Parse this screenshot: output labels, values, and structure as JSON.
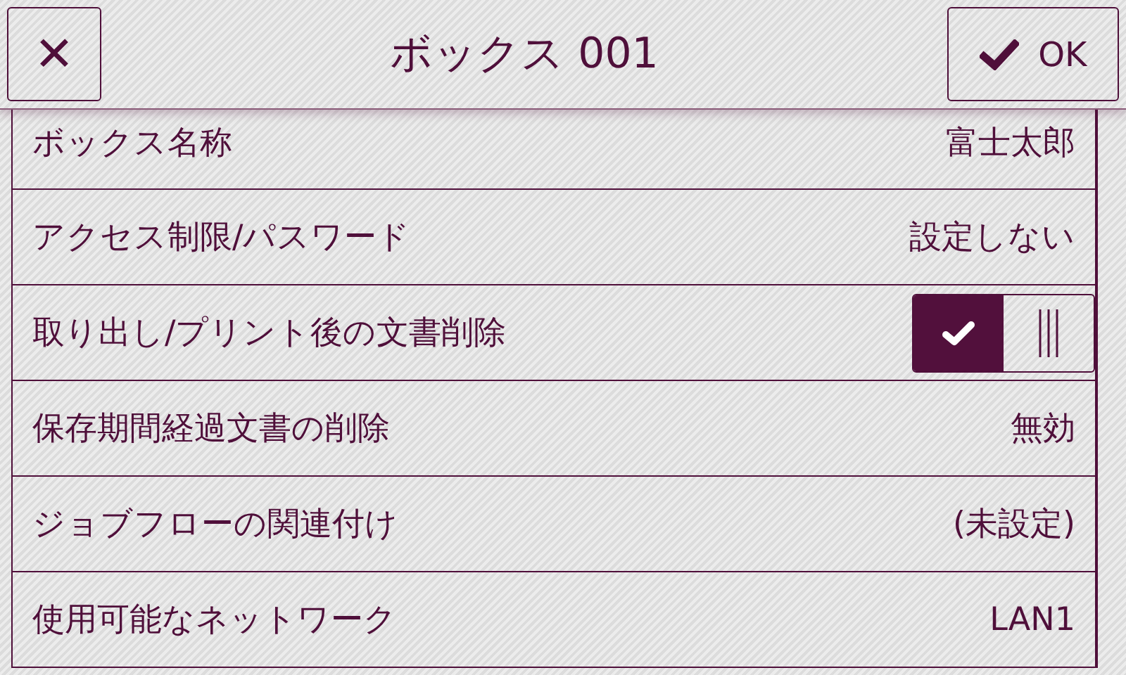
{
  "header": {
    "close_label": "✕",
    "title": "ボックス 001",
    "ok_label": "OK"
  },
  "rows": [
    {
      "kind": "value",
      "label": "ボックス名称",
      "value": "富士太郎"
    },
    {
      "kind": "value",
      "label": "アクセス制限/パスワード",
      "value": "設定しない"
    },
    {
      "kind": "toggle",
      "label": "取り出し/プリント後の文書削除",
      "on": true
    },
    {
      "kind": "value",
      "label": "保存期間経過文書の削除",
      "value": "無効"
    },
    {
      "kind": "value",
      "label": "ジョブフローの関連付け",
      "value": "(未設定)"
    },
    {
      "kind": "value",
      "label": "使用可能なネットワーク",
      "value": "LAN1"
    }
  ]
}
